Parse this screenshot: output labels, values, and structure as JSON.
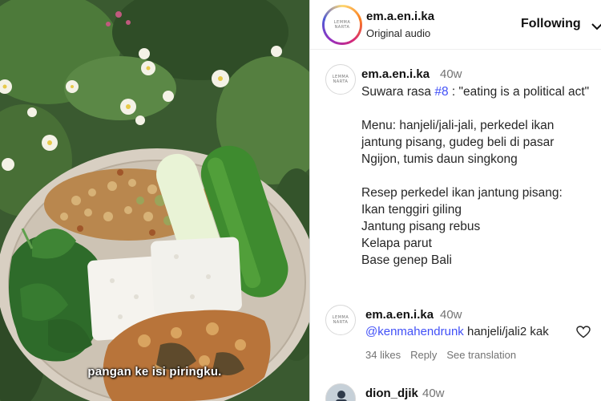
{
  "header": {
    "username": "em.a.en.i.ka",
    "audio": "Original audio",
    "follow_label": "Following",
    "avatar_logo": "LEMMAKEN\nNARTA"
  },
  "video": {
    "subtitle": "pangan ke isi piringku."
  },
  "caption": {
    "username": "em.a.en.i.ka",
    "time": "40w",
    "line1_prefix": "Suwara rasa ",
    "hashtag": "#8",
    "line1_suffix": " : \"eating is a political act\"",
    "menu": "Menu: hanjeli/jali-jali, perkedel ikan jantung pisang, gudeg beli di pasar Ngijon, tumis daun singkong",
    "recipe_title": "Resep perkedel ikan jantung pisang:",
    "ingredients": [
      "Ikan tenggiri giling",
      "Jantung pisang rebus",
      "Kelapa parut",
      "Base genep Bali"
    ]
  },
  "comment": {
    "username": "em.a.en.i.ka",
    "time": "40w",
    "mention": "@kenmahendrunk",
    "text": " hanjeli/jali2 kak",
    "likes": "34 likes",
    "reply": "Reply",
    "translate": "See translation"
  },
  "comment2": {
    "username": "dion_djik",
    "time": "40w"
  },
  "icons": {
    "heart": "heart-outline-icon",
    "chevron": "chevron-down-icon"
  },
  "colors": {
    "link": "#4150f7",
    "muted": "#737373"
  }
}
